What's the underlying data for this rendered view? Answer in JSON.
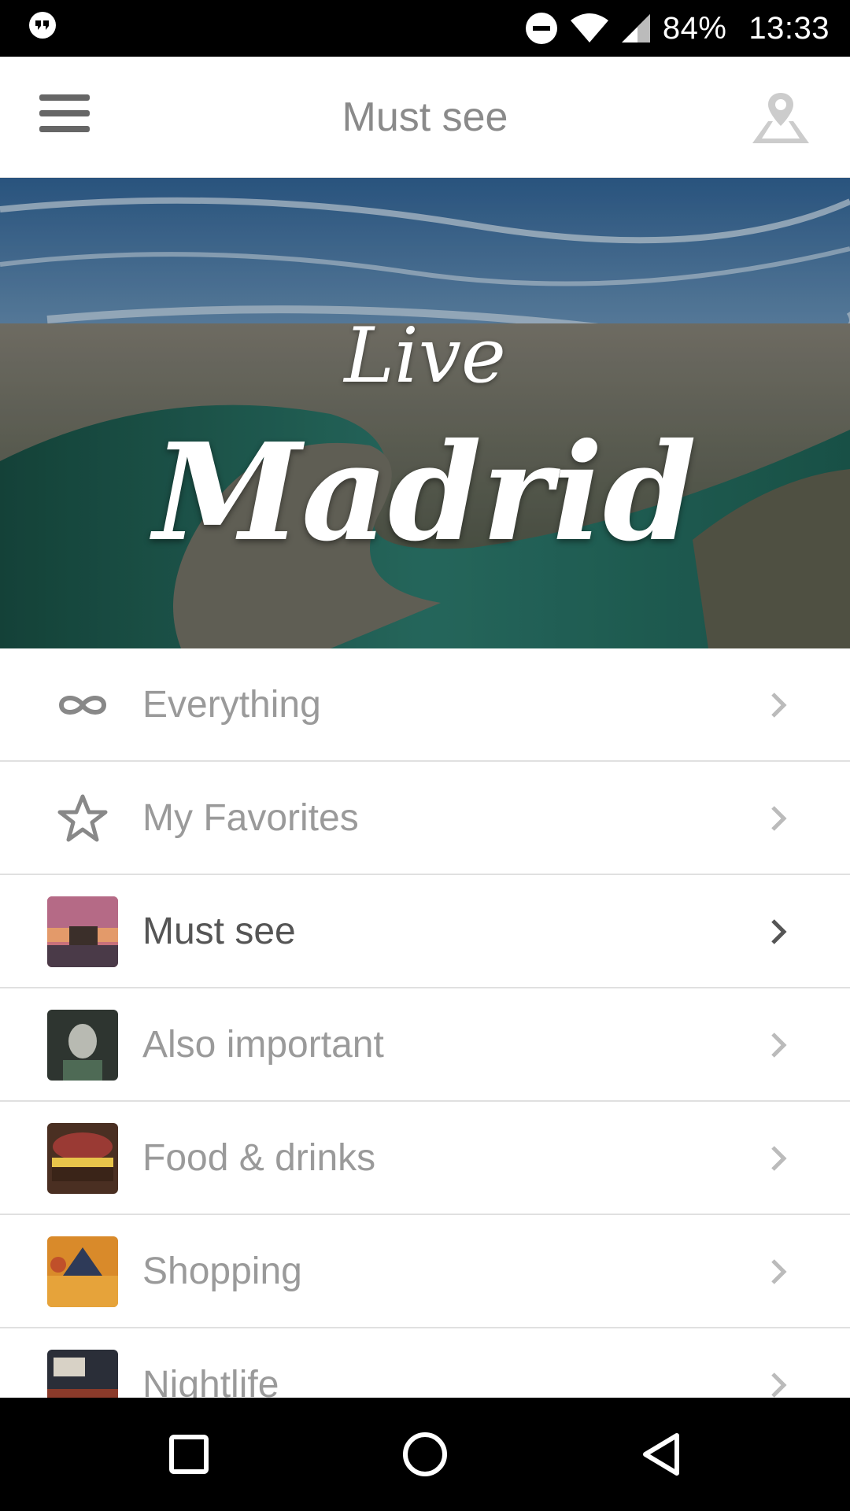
{
  "status_bar": {
    "battery_pct": "84%",
    "time": "13:33",
    "icons": [
      "hangouts-icon",
      "do-not-disturb-icon",
      "wifi-icon",
      "signal-icon"
    ]
  },
  "app_bar": {
    "title": "Must see",
    "menu_icon": "hamburger-menu-icon",
    "map_icon": "map-pin-icon"
  },
  "hero": {
    "small_text": "Live",
    "big_text": "Madrid"
  },
  "categories": [
    {
      "label": "Everything",
      "icon": "infinity-icon",
      "active": false
    },
    {
      "label": "My Favorites",
      "icon": "star-icon",
      "active": false
    },
    {
      "label": "Must see",
      "icon": "temple-thumbnail",
      "active": true
    },
    {
      "label": "Also important",
      "icon": "portrait-thumbnail",
      "active": false
    },
    {
      "label": "Food & drinks",
      "icon": "burger-thumbnail",
      "active": false
    },
    {
      "label": "Shopping",
      "icon": "market-thumbnail",
      "active": false
    },
    {
      "label": "Nightlife",
      "icon": "bar-thumbnail",
      "active": false
    }
  ],
  "nav_bar": {
    "icons": [
      "recents-square-icon",
      "home-circle-icon",
      "back-triangle-icon"
    ]
  },
  "colors": {
    "active_text": "#555555",
    "inactive_text": "#9a9a9a",
    "divider": "#e0e0e0"
  }
}
